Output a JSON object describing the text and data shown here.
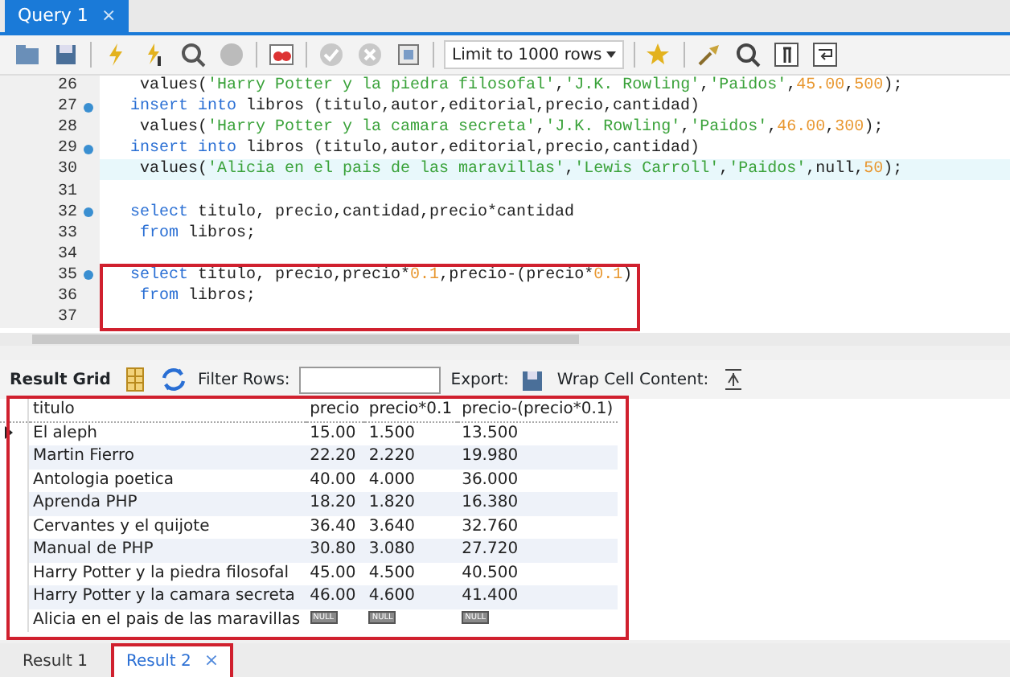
{
  "query_tabs": [
    {
      "label": "Query 1",
      "selected": true,
      "close": "×"
    }
  ],
  "toolbar": {
    "limit_select": "Limit to 1000 rows"
  },
  "editor": {
    "lines": [
      {
        "number": "26",
        "marker": false,
        "current": false,
        "outlined": false,
        "tokens": [
          {
            "kind": "plain",
            "text": " values("
          },
          {
            "kind": "str",
            "text": "'Harry Potter y la piedra filosofal'"
          },
          {
            "kind": "plain",
            "text": ","
          },
          {
            "kind": "str",
            "text": "'J.K. Rowling'"
          },
          {
            "kind": "plain",
            "text": ","
          },
          {
            "kind": "str",
            "text": "'Paidos'"
          },
          {
            "kind": "plain",
            "text": ","
          },
          {
            "kind": "num",
            "text": "45.00"
          },
          {
            "kind": "plain",
            "text": ","
          },
          {
            "kind": "num",
            "text": "500"
          },
          {
            "kind": "plain",
            "text": ");"
          }
        ]
      },
      {
        "number": "27",
        "marker": true,
        "current": false,
        "outlined": false,
        "tokens": [
          {
            "kind": "kw",
            "text": "insert into"
          },
          {
            "kind": "plain",
            "text": " libros (titulo,autor,editorial,precio,cantidad)"
          }
        ]
      },
      {
        "number": "28",
        "marker": false,
        "current": false,
        "outlined": false,
        "tokens": [
          {
            "kind": "plain",
            "text": " values("
          },
          {
            "kind": "str",
            "text": "'Harry Potter y la camara secreta'"
          },
          {
            "kind": "plain",
            "text": ","
          },
          {
            "kind": "str",
            "text": "'J.K. Rowling'"
          },
          {
            "kind": "plain",
            "text": ","
          },
          {
            "kind": "str",
            "text": "'Paidos'"
          },
          {
            "kind": "plain",
            "text": ","
          },
          {
            "kind": "num",
            "text": "46.00"
          },
          {
            "kind": "plain",
            "text": ","
          },
          {
            "kind": "num",
            "text": "300"
          },
          {
            "kind": "plain",
            "text": ");"
          }
        ]
      },
      {
        "number": "29",
        "marker": true,
        "current": false,
        "outlined": false,
        "tokens": [
          {
            "kind": "kw",
            "text": "insert into"
          },
          {
            "kind": "plain",
            "text": " libros (titulo,autor,editorial,precio,cantidad)"
          }
        ]
      },
      {
        "number": "30",
        "marker": false,
        "current": true,
        "outlined": false,
        "tokens": [
          {
            "kind": "plain",
            "text": " values("
          },
          {
            "kind": "str",
            "text": "'Alicia en el pais de las maravillas'"
          },
          {
            "kind": "plain",
            "text": ","
          },
          {
            "kind": "str",
            "text": "'Lewis Carroll'"
          },
          {
            "kind": "plain",
            "text": ","
          },
          {
            "kind": "str",
            "text": "'Paidos'"
          },
          {
            "kind": "plain",
            "text": ",null,"
          },
          {
            "kind": "num",
            "text": "50"
          },
          {
            "kind": "plain",
            "text": ");"
          }
        ]
      },
      {
        "number": "31",
        "marker": false,
        "current": false,
        "outlined": false
      },
      {
        "number": "32",
        "marker": true,
        "current": false,
        "outlined": false,
        "tokens": [
          {
            "kind": "kw",
            "text": "select"
          },
          {
            "kind": "plain",
            "text": " titulo, precio,cantidad,precio*cantidad"
          }
        ]
      },
      {
        "number": "33",
        "marker": false,
        "current": false,
        "outlined": false,
        "indent": true,
        "tokens": [
          {
            "kind": "kw",
            "text": "from"
          },
          {
            "kind": "plain",
            "text": " libros;"
          }
        ]
      },
      {
        "number": "34",
        "marker": false,
        "current": false,
        "outlined": false
      },
      {
        "number": "35",
        "marker": true,
        "current": false,
        "outlined": true,
        "tokens": [
          {
            "kind": "kw",
            "text": "select"
          },
          {
            "kind": "plain",
            "text": " titulo, precio,precio*"
          },
          {
            "kind": "num",
            "text": "0.1"
          },
          {
            "kind": "plain",
            "text": ",precio-(precio*"
          },
          {
            "kind": "num",
            "text": "0.1"
          },
          {
            "kind": "plain",
            "text": ")"
          }
        ]
      },
      {
        "number": "36",
        "marker": false,
        "current": false,
        "outlined": true,
        "indent": true,
        "tokens": [
          {
            "kind": "kw",
            "text": "from"
          },
          {
            "kind": "plain",
            "text": " libros;"
          }
        ]
      },
      {
        "number": "37",
        "marker": false,
        "current": false,
        "outlined": true
      }
    ]
  },
  "result_toolbar": {
    "result_grid": "Result Grid",
    "filter_label": "Filter Rows:",
    "export_label": "Export:",
    "wrap_label": "Wrap Cell Content:"
  },
  "grid": {
    "outlined": true,
    "columns": [
      "titulo",
      "precio",
      "precio*0.1",
      "precio-(precio*0.1)"
    ],
    "rows": [
      {
        "selected": true,
        "cells": [
          "El aleph",
          "15.00",
          "1.500",
          "13.500"
        ]
      },
      {
        "selected": false,
        "cells": [
          "Martin Fierro",
          "22.20",
          "2.220",
          "19.980"
        ]
      },
      {
        "selected": false,
        "cells": [
          "Antologia poetica",
          "40.00",
          "4.000",
          "36.000"
        ]
      },
      {
        "selected": false,
        "cells": [
          "Aprenda PHP",
          "18.20",
          "1.820",
          "16.380"
        ]
      },
      {
        "selected": false,
        "cells": [
          "Cervantes y el quijote",
          "36.40",
          "3.640",
          "32.760"
        ]
      },
      {
        "selected": false,
        "cells": [
          "Manual de PHP",
          "30.80",
          "3.080",
          "27.720"
        ]
      },
      {
        "selected": false,
        "cells": [
          "Harry Potter y la piedra filosofal",
          "45.00",
          "4.500",
          "40.500"
        ]
      },
      {
        "selected": false,
        "cells": [
          "Harry Potter y la camara secreta",
          "46.00",
          "4.600",
          "41.400"
        ]
      },
      {
        "selected": false,
        "cells": [
          "Alicia en el pais de las maravillas",
          {
            "kind": "null",
            "text": "NULL"
          },
          {
            "kind": "null",
            "text": "NULL"
          },
          {
            "kind": "null",
            "text": "NULL"
          }
        ]
      }
    ]
  },
  "result_tabs": [
    {
      "label": "Result 1",
      "selected": false,
      "outlined": false
    },
    {
      "label": "Result 2",
      "selected": true,
      "outlined": true,
      "close": "×"
    }
  ]
}
